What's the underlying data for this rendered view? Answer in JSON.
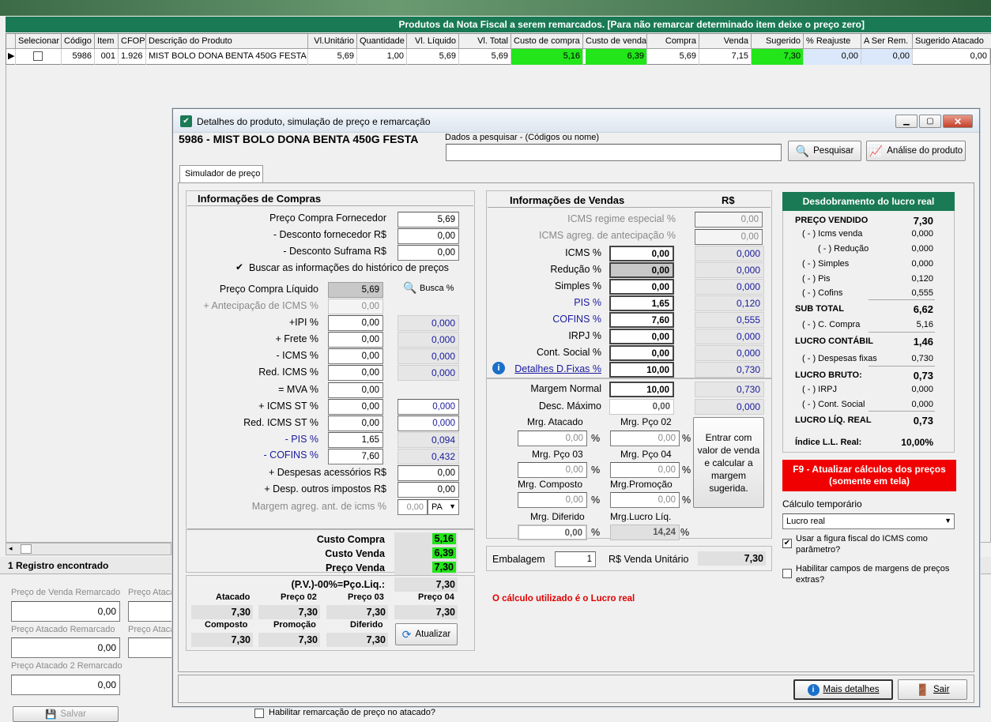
{
  "main_grid": {
    "title": "Produtos da Nota Fiscal a serem remarcados. [Para não remarcar determinado item deixe o preço zero]",
    "headers": [
      "Selecionar",
      "Código",
      "Item",
      "CFOP",
      "Descrição do Produto",
      "Vl.Unitário",
      "Quantidade",
      "Vl. Líquido",
      "Vl. Total",
      "Custo de compra",
      "Custo de venda",
      "Compra",
      "Venda",
      "Sugerido",
      "% Reajuste",
      "A Ser Rem.",
      "Sugerido Atacado"
    ],
    "row": {
      "codigo": "5986",
      "item": "001",
      "cfop": "1.926",
      "descricao": "MIST BOLO DONA BENTA 450G FESTA",
      "vl_unitario": "5,69",
      "quantidade": "1,00",
      "vl_liquido": "5,69",
      "vl_total": "5,69",
      "custo_compra": "5,16",
      "custo_venda": "6,39",
      "compra": "5,69",
      "venda": "7,15",
      "sugerido": "7,30",
      "reajuste": "0,00",
      "a_ser_rem": "0,00",
      "sugerido_atacado": "0,00"
    }
  },
  "left_panel": {
    "registros": "1 Registro encontrado",
    "preco_venda_remarcado_label": "Preço de Venda Remarcado",
    "preco_venda_remarcado": "0,00",
    "preco_atacado_label_cut": "Preço Ataca",
    "preco_atacado_remarcado_label": "Preço Atacado Remarcado",
    "preco_atacado_remarcado": "0,00",
    "preco_atacado_label_cut2": "Preço Ataca",
    "preco_atacado2_remarcado_label": "Preço Atacado 2 Remarcado",
    "preco_atacado2_remarcado": "0,00",
    "salvar_label": "Salvar",
    "habilitar_atacado_label": "Habilitar remarcação de preço no atacado?"
  },
  "dialog": {
    "title": "Detalhes do produto, simulação de preço e remarcação",
    "product_heading": "5986 - MIST BOLO DONA BENTA 450G FESTA",
    "search_label": "Dados a pesquisar - (Códigos ou nome)",
    "search_value": "",
    "pesquisar_label": "Pesquisar",
    "analise_label": "Análise do produto",
    "tab_label": "Simulador de preço",
    "mais_detalhes_label": "Mais detalhes",
    "sair_label": "Sair"
  },
  "compras": {
    "header": "Informações de Compras",
    "preco_compra_fornecedor_label": "Preço Compra Fornecedor",
    "preco_compra_fornecedor": "5,69",
    "desconto_fornecedor_label": "- Desconto fornecedor R$",
    "desconto_fornecedor": "0,00",
    "desconto_suframa_label": "- Desconto Suframa R$",
    "desconto_suframa": "0,00",
    "buscar_historico_label": "Buscar as informações do histórico de preços",
    "preco_compra_liquido_label": "Preço Compra Líquido",
    "preco_compra_liquido": "5,69",
    "busca_pct_label": "Busca %",
    "antecipacao_icms_label": "+ Antecipação de ICMS %",
    "antecipacao_icms": "0,00",
    "ipi_label": "+IPI %",
    "ipi": "0,00",
    "ipi_val": "0,000",
    "frete_label": "+ Frete %",
    "frete": "0,00",
    "frete_val": "0,000",
    "icms_label": "- ICMS %",
    "icms": "0,00",
    "icms_val": "0,000",
    "red_icms_label": "Red. ICMS %",
    "red_icms": "0,00",
    "red_icms_val": "0,000",
    "mva_label": "= MVA %",
    "mva": "0,00",
    "icms_st_label": "+ ICMS ST %",
    "icms_st": "0,00",
    "icms_st_val": "0,000",
    "red_icms_st_label": "Red. ICMS ST %",
    "red_icms_st": "0,00",
    "red_icms_st_val": "0,000",
    "pis_label": "- PIS %",
    "pis": "1,65",
    "pis_val": "0,094",
    "cofins_label": "- COFINS %",
    "cofins": "7,60",
    "cofins_val": "0,432",
    "despesas_acessorios_label": "+ Despesas acessórios R$",
    "despesas_acessorios": "0,00",
    "desp_outros_label": "+ Desp. outros impostos R$",
    "desp_outros": "0,00",
    "margem_agreg_label": "Margem agreg. ant. de icms %",
    "margem_agreg": "0,00",
    "margem_agreg_sel": "PA",
    "custo_compra_label": "Custo Compra",
    "custo_compra": "5,16",
    "custo_venda_label": "Custo Venda",
    "custo_venda": "6,39",
    "preco_venda_label": "Preço Venda",
    "preco_venda": "7,30",
    "pv_label": "(P.V.)-00%=Pço.Liq.:",
    "pv": "7,30",
    "atacado_label": "Atacado",
    "atacado": "7,30",
    "preco02_label": "Preço 02",
    "preco02": "7,30",
    "preco03_label": "Preço 03",
    "preco03": "7,30",
    "preco04_label": "Preço 04",
    "preco04": "7,30",
    "composto_label": "Composto",
    "composto": "7,30",
    "promocao_label": "Promoção",
    "promocao": "7,30",
    "diferido_label": "Diferido",
    "diferido": "7,30",
    "atualizar_label": "Atualizar"
  },
  "vendas": {
    "header": "Informações de Vendas",
    "rs_header": "R$",
    "icms_especial_label": "ICMS regime especial %",
    "icms_especial": "0,00",
    "icms_agreg_label": "ICMS agreg. de antecipação %",
    "icms_agreg": "0,00",
    "icms_label": "ICMS %",
    "icms": "0,00",
    "icms_val": "0,000",
    "reducao_label": "Redução %",
    "reducao": "0,00",
    "reducao_val": "0,000",
    "simples_label": "Simples %",
    "simples": "0,00",
    "simples_val": "0,000",
    "pis_label": "PIS %",
    "pis": "1,65",
    "pis_val": "0,120",
    "cofins_label": "COFINS %",
    "cofins": "7,60",
    "cofins_val": "0,555",
    "irpj_label": "IRPJ %",
    "irpj": "0,00",
    "irpj_val": "0,000",
    "cont_social_label": "Cont. Social %",
    "cont_social": "0,00",
    "cont_social_val": "0,000",
    "detalhes_fixas_label": "Detalhes D.Fixas %",
    "detalhes_fixas": "10,00",
    "detalhes_fixas_val": "0,730",
    "margem_normal_label": "Margem Normal",
    "margem_normal": "10,00",
    "margem_normal_val": "0,730",
    "desc_maximo_label": "Desc. Máximo",
    "desc_maximo": "0,00",
    "desc_maximo_val": "0,000",
    "mrg_atacado_label": "Mrg. Atacado",
    "mrg_atacado": "0,00",
    "mrg_pco02_label": "Mrg. Pço 02",
    "mrg_pco02": "0,00",
    "mrg_pco03_label": "Mrg. Pço 03",
    "mrg_pco03": "0,00",
    "mrg_pco04_label": "Mrg. Pço 04",
    "mrg_pco04": "0,00",
    "mrg_composto_label": "Mrg. Composto",
    "mrg_composto": "0,00",
    "mrg_promocao_label": "Mrg.Promoção",
    "mrg_promocao": "0,00",
    "mrg_diferido_label": "Mrg. Diferido",
    "mrg_diferido": "0,00",
    "mrg_lucro_liq_label": "Mrg.Lucro Líq.",
    "mrg_lucro_liq": "14,24",
    "pct": "%",
    "entrar_label": "Entrar com valor de venda e calcular a margem sugerida.",
    "embalagem_label": "Embalagem",
    "embalagem": "1",
    "venda_unitario_label": "R$ Venda Unitário",
    "venda_unitario": "7,30",
    "calculo_msg": "O cálculo utilizado é o Lucro real"
  },
  "lucro": {
    "header": "Desdobramento do lucro real",
    "preco_vendido_label": "PREÇO VENDIDO",
    "preco_vendido": "7,30",
    "icms_venda_label": "( - ) Icms venda",
    "icms_venda": "0,000",
    "reducao_label": "( - ) Redução",
    "reducao": "0,000",
    "simples_label": "( - ) Simples",
    "simples": "0,000",
    "pis_label": "( - ) Pis",
    "pis": "0,120",
    "cofins_label": "( - ) Cofins",
    "cofins": "0,555",
    "sub_total_label": "SUB TOTAL",
    "sub_total": "6,62",
    "c_compra_label": "( - ) C. Compra",
    "c_compra": "5,16",
    "lucro_contabil_label": "LUCRO CONTÁBIL",
    "lucro_contabil": "1,46",
    "despesas_fixas_label": "( - ) Despesas fixas",
    "despesas_fixas": "0,730",
    "lucro_bruto_label": "LUCRO BRUTO:",
    "lucro_bruto": "0,73",
    "irpj_label": "( - ) IRPJ",
    "irpj": "0,000",
    "cont_social_label": "( - ) Cont. Social",
    "cont_social": "0,000",
    "lucro_liq_label": "LUCRO LÍQ. REAL",
    "lucro_liq": "0,73",
    "indice_label": "Índice L.L. Real:",
    "indice": "10,00%",
    "f9_label": "F9 - Atualizar cálculos dos preços (somente em tela)",
    "calculo_temporario_label": "Cálculo temporário",
    "calculo_temporario": "Lucro real",
    "usar_figura_label": "Usar a figura fiscal do ICMS como parâmetro?",
    "habilitar_margens_label": "Habilitar campos de margens de preços extras?"
  },
  "colors": {
    "accent_green": "#1a7a56",
    "highlight_green": "#22e51a",
    "f9_red": "#f00000",
    "value_blue": "#1a1a9e"
  }
}
